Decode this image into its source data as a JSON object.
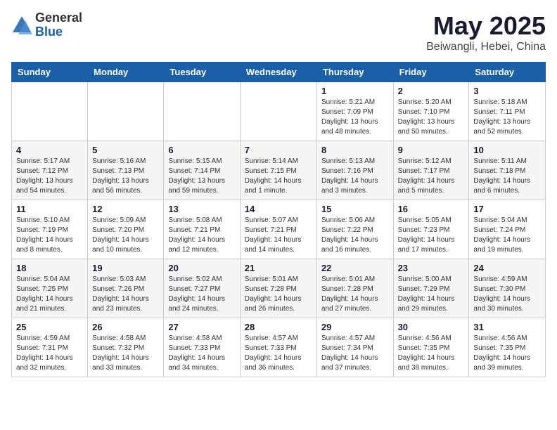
{
  "logo": {
    "general": "General",
    "blue": "Blue"
  },
  "header": {
    "title": "May 2025",
    "subtitle": "Beiwangli, Hebei, China"
  },
  "weekdays": [
    "Sunday",
    "Monday",
    "Tuesday",
    "Wednesday",
    "Thursday",
    "Friday",
    "Saturday"
  ],
  "weeks": [
    [
      {
        "day": "",
        "info": ""
      },
      {
        "day": "",
        "info": ""
      },
      {
        "day": "",
        "info": ""
      },
      {
        "day": "",
        "info": ""
      },
      {
        "day": "1",
        "info": "Sunrise: 5:21 AM\nSunset: 7:09 PM\nDaylight: 13 hours\nand 48 minutes."
      },
      {
        "day": "2",
        "info": "Sunrise: 5:20 AM\nSunset: 7:10 PM\nDaylight: 13 hours\nand 50 minutes."
      },
      {
        "day": "3",
        "info": "Sunrise: 5:18 AM\nSunset: 7:11 PM\nDaylight: 13 hours\nand 52 minutes."
      }
    ],
    [
      {
        "day": "4",
        "info": "Sunrise: 5:17 AM\nSunset: 7:12 PM\nDaylight: 13 hours\nand 54 minutes."
      },
      {
        "day": "5",
        "info": "Sunrise: 5:16 AM\nSunset: 7:13 PM\nDaylight: 13 hours\nand 56 minutes."
      },
      {
        "day": "6",
        "info": "Sunrise: 5:15 AM\nSunset: 7:14 PM\nDaylight: 13 hours\nand 59 minutes."
      },
      {
        "day": "7",
        "info": "Sunrise: 5:14 AM\nSunset: 7:15 PM\nDaylight: 14 hours\nand 1 minute."
      },
      {
        "day": "8",
        "info": "Sunrise: 5:13 AM\nSunset: 7:16 PM\nDaylight: 14 hours\nand 3 minutes."
      },
      {
        "day": "9",
        "info": "Sunrise: 5:12 AM\nSunset: 7:17 PM\nDaylight: 14 hours\nand 5 minutes."
      },
      {
        "day": "10",
        "info": "Sunrise: 5:11 AM\nSunset: 7:18 PM\nDaylight: 14 hours\nand 6 minutes."
      }
    ],
    [
      {
        "day": "11",
        "info": "Sunrise: 5:10 AM\nSunset: 7:19 PM\nDaylight: 14 hours\nand 8 minutes."
      },
      {
        "day": "12",
        "info": "Sunrise: 5:09 AM\nSunset: 7:20 PM\nDaylight: 14 hours\nand 10 minutes."
      },
      {
        "day": "13",
        "info": "Sunrise: 5:08 AM\nSunset: 7:21 PM\nDaylight: 14 hours\nand 12 minutes."
      },
      {
        "day": "14",
        "info": "Sunrise: 5:07 AM\nSunset: 7:21 PM\nDaylight: 14 hours\nand 14 minutes."
      },
      {
        "day": "15",
        "info": "Sunrise: 5:06 AM\nSunset: 7:22 PM\nDaylight: 14 hours\nand 16 minutes."
      },
      {
        "day": "16",
        "info": "Sunrise: 5:05 AM\nSunset: 7:23 PM\nDaylight: 14 hours\nand 17 minutes."
      },
      {
        "day": "17",
        "info": "Sunrise: 5:04 AM\nSunset: 7:24 PM\nDaylight: 14 hours\nand 19 minutes."
      }
    ],
    [
      {
        "day": "18",
        "info": "Sunrise: 5:04 AM\nSunset: 7:25 PM\nDaylight: 14 hours\nand 21 minutes."
      },
      {
        "day": "19",
        "info": "Sunrise: 5:03 AM\nSunset: 7:26 PM\nDaylight: 14 hours\nand 23 minutes."
      },
      {
        "day": "20",
        "info": "Sunrise: 5:02 AM\nSunset: 7:27 PM\nDaylight: 14 hours\nand 24 minutes."
      },
      {
        "day": "21",
        "info": "Sunrise: 5:01 AM\nSunset: 7:28 PM\nDaylight: 14 hours\nand 26 minutes."
      },
      {
        "day": "22",
        "info": "Sunrise: 5:01 AM\nSunset: 7:28 PM\nDaylight: 14 hours\nand 27 minutes."
      },
      {
        "day": "23",
        "info": "Sunrise: 5:00 AM\nSunset: 7:29 PM\nDaylight: 14 hours\nand 29 minutes."
      },
      {
        "day": "24",
        "info": "Sunrise: 4:59 AM\nSunset: 7:30 PM\nDaylight: 14 hours\nand 30 minutes."
      }
    ],
    [
      {
        "day": "25",
        "info": "Sunrise: 4:59 AM\nSunset: 7:31 PM\nDaylight: 14 hours\nand 32 minutes."
      },
      {
        "day": "26",
        "info": "Sunrise: 4:58 AM\nSunset: 7:32 PM\nDaylight: 14 hours\nand 33 minutes."
      },
      {
        "day": "27",
        "info": "Sunrise: 4:58 AM\nSunset: 7:33 PM\nDaylight: 14 hours\nand 34 minutes."
      },
      {
        "day": "28",
        "info": "Sunrise: 4:57 AM\nSunset: 7:33 PM\nDaylight: 14 hours\nand 36 minutes."
      },
      {
        "day": "29",
        "info": "Sunrise: 4:57 AM\nSunset: 7:34 PM\nDaylight: 14 hours\nand 37 minutes."
      },
      {
        "day": "30",
        "info": "Sunrise: 4:56 AM\nSunset: 7:35 PM\nDaylight: 14 hours\nand 38 minutes."
      },
      {
        "day": "31",
        "info": "Sunrise: 4:56 AM\nSunset: 7:35 PM\nDaylight: 14 hours\nand 39 minutes."
      }
    ]
  ]
}
